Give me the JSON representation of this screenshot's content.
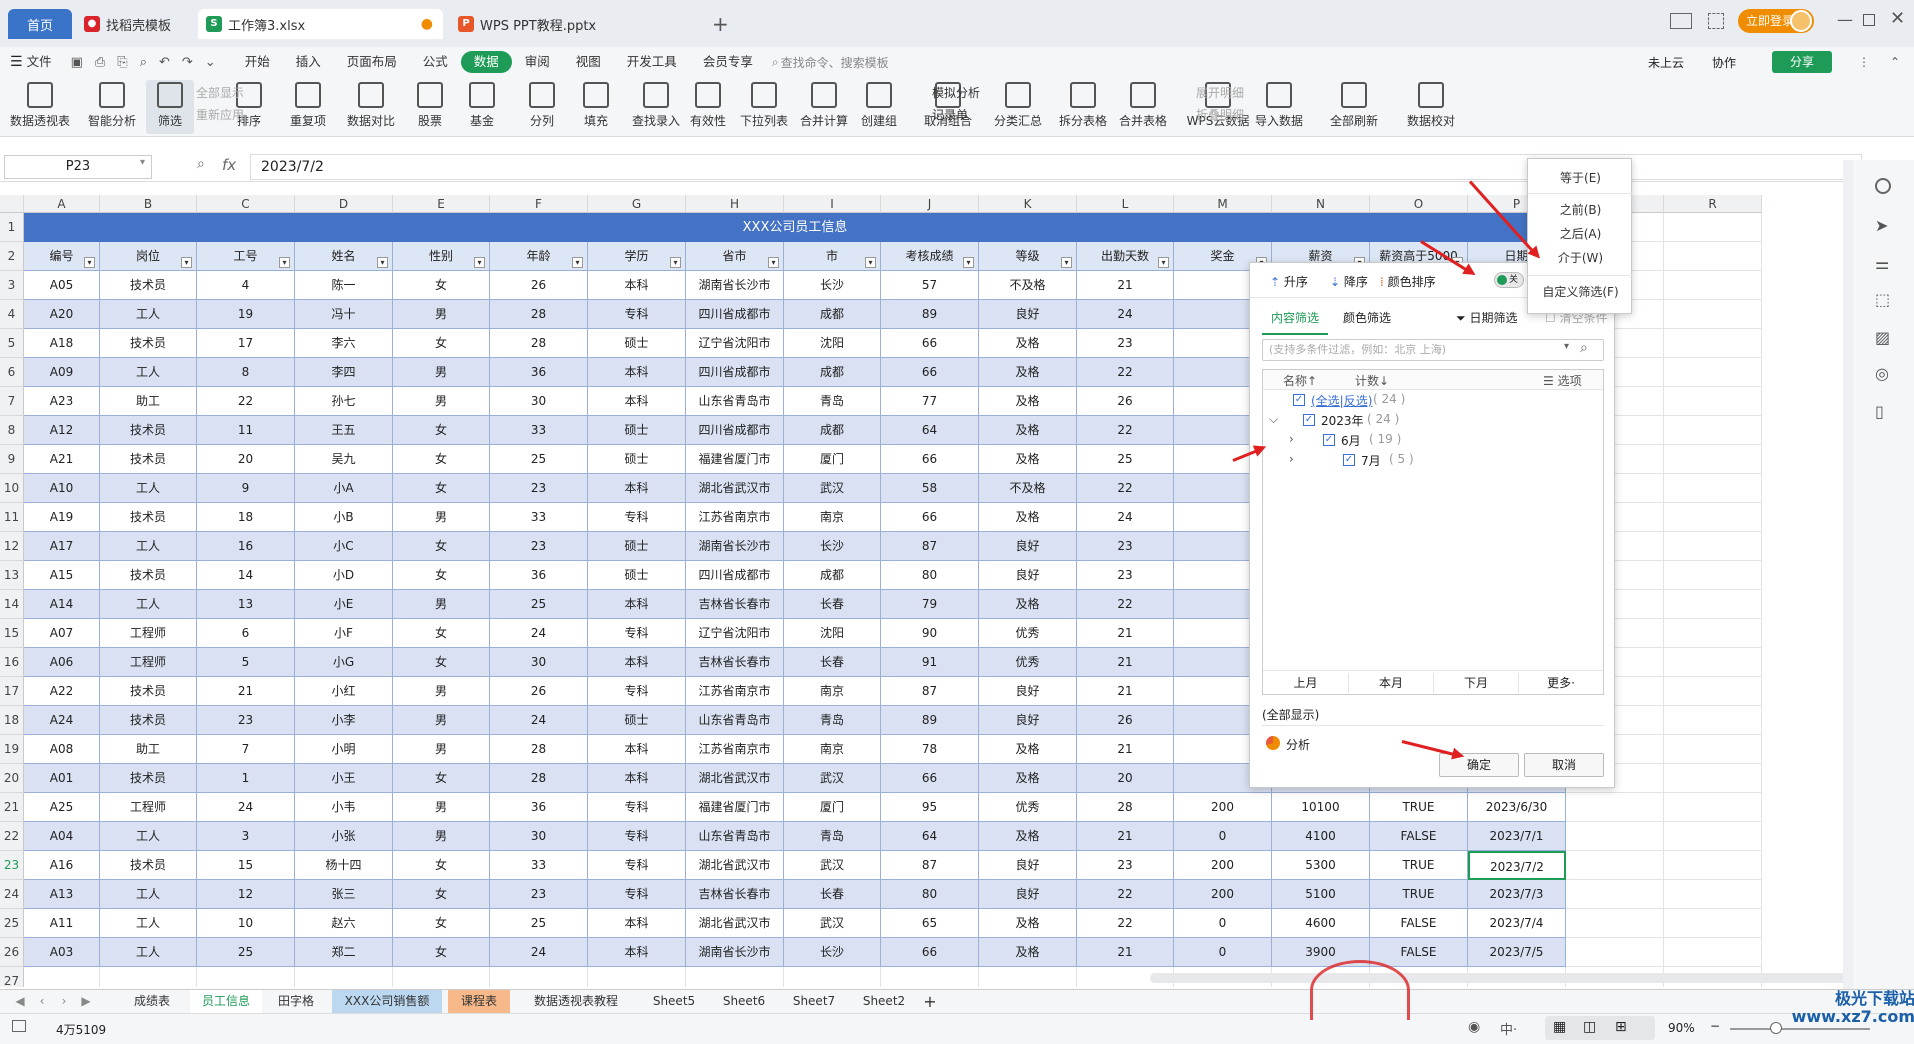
{
  "titlebar": {
    "tabs": [
      {
        "label": "首页"
      },
      {
        "label": "找稻壳模板"
      },
      {
        "label": "工作簿3.xlsx"
      },
      {
        "label": "WPS PPT教程.pptx"
      }
    ],
    "login": "立即登录"
  },
  "menu": {
    "items": [
      "文件",
      "开始",
      "插入",
      "页面布局",
      "公式",
      "数据",
      "审阅",
      "视图",
      "开发工具",
      "会员专享"
    ],
    "active": "数据",
    "search_placeholder": "查找命令、搜索模板",
    "cloud": "未上云",
    "collab": "协作",
    "share": "分享"
  },
  "ribbon": {
    "buttons": [
      "数据透视表",
      "智能分析",
      "筛选",
      "排序",
      "重复项",
      "数据对比",
      "股票",
      "基金",
      "分列",
      "填充",
      "查找录入",
      "有效性",
      "下拉列表",
      "合并计算",
      "创建组",
      "取消组合",
      "分类汇总",
      "拆分表格",
      "合并表格",
      "WPS云数据",
      "导入数据",
      "全部刷新",
      "数据校对"
    ],
    "small": {
      "show_all": "全部显示",
      "reapply": "重新应用",
      "sim_analysis": "模拟分析",
      "record": "记录单",
      "expand": "展开明细",
      "collapse": "折叠明细"
    }
  },
  "formula": {
    "cellref": "P23",
    "fx": "fx",
    "value": "2023/7/2"
  },
  "columns": [
    "A",
    "B",
    "C",
    "D",
    "E",
    "F",
    "G",
    "H",
    "I",
    "J",
    "K",
    "L",
    "M",
    "N",
    "O",
    "P",
    "Q",
    "R"
  ],
  "sheet_title": "XXX公司员工信息",
  "headers": [
    "编号",
    "岗位",
    "工号",
    "姓名",
    "性别",
    "年龄",
    "学历",
    "省市",
    "市",
    "考核成绩",
    "等级",
    "出勤天数",
    "奖金",
    "薪资",
    "薪资高于5000",
    "日期"
  ],
  "rows": [
    [
      "A05",
      "技术员",
      "4",
      "陈一",
      "女",
      "26",
      "本科",
      "湖南省长沙市",
      "长沙",
      "57",
      "不及格",
      "21",
      "",
      "",
      "",
      ""
    ],
    [
      "A20",
      "工人",
      "19",
      "冯十",
      "男",
      "28",
      "专科",
      "四川省成都市",
      "成都",
      "89",
      "良好",
      "24",
      "",
      "",
      "",
      ""
    ],
    [
      "A18",
      "技术员",
      "17",
      "李六",
      "女",
      "28",
      "硕士",
      "辽宁省沈阳市",
      "沈阳",
      "66",
      "及格",
      "23",
      "",
      "",
      "",
      ""
    ],
    [
      "A09",
      "工人",
      "8",
      "李四",
      "男",
      "36",
      "本科",
      "四川省成都市",
      "成都",
      "66",
      "及格",
      "22",
      "",
      "",
      "",
      ""
    ],
    [
      "A23",
      "助工",
      "22",
      "孙七",
      "男",
      "30",
      "本科",
      "山东省青岛市",
      "青岛",
      "77",
      "及格",
      "26",
      "",
      "",
      "",
      ""
    ],
    [
      "A12",
      "技术员",
      "11",
      "王五",
      "女",
      "33",
      "硕士",
      "四川省成都市",
      "成都",
      "64",
      "及格",
      "22",
      "",
      "",
      "",
      ""
    ],
    [
      "A21",
      "技术员",
      "20",
      "吴九",
      "女",
      "25",
      "硕士",
      "福建省厦门市",
      "厦门",
      "66",
      "及格",
      "25",
      "",
      "",
      "",
      ""
    ],
    [
      "A10",
      "工人",
      "9",
      "小A",
      "女",
      "23",
      "本科",
      "湖北省武汉市",
      "武汉",
      "58",
      "不及格",
      "22",
      "",
      "",
      "",
      ""
    ],
    [
      "A19",
      "技术员",
      "18",
      "小B",
      "男",
      "33",
      "专科",
      "江苏省南京市",
      "南京",
      "66",
      "及格",
      "24",
      "",
      "",
      "",
      ""
    ],
    [
      "A17",
      "工人",
      "16",
      "小C",
      "女",
      "23",
      "硕士",
      "湖南省长沙市",
      "长沙",
      "87",
      "良好",
      "23",
      "",
      "",
      "",
      ""
    ],
    [
      "A15",
      "技术员",
      "14",
      "小D",
      "女",
      "36",
      "硕士",
      "四川省成都市",
      "成都",
      "80",
      "良好",
      "23",
      "",
      "",
      "",
      ""
    ],
    [
      "A14",
      "工人",
      "13",
      "小E",
      "男",
      "25",
      "本科",
      "吉林省长春市",
      "长春",
      "79",
      "及格",
      "22",
      "",
      "",
      "",
      ""
    ],
    [
      "A07",
      "工程师",
      "6",
      "小F",
      "女",
      "24",
      "专科",
      "辽宁省沈阳市",
      "沈阳",
      "90",
      "优秀",
      "21",
      "",
      "",
      "",
      ""
    ],
    [
      "A06",
      "工程师",
      "5",
      "小G",
      "女",
      "30",
      "本科",
      "吉林省长春市",
      "长春",
      "91",
      "优秀",
      "21",
      "",
      "",
      "",
      ""
    ],
    [
      "A22",
      "技术员",
      "21",
      "小红",
      "男",
      "26",
      "专科",
      "江苏省南京市",
      "南京",
      "87",
      "良好",
      "21",
      "",
      "",
      "",
      ""
    ],
    [
      "A24",
      "技术员",
      "23",
      "小李",
      "男",
      "24",
      "硕士",
      "山东省青岛市",
      "青岛",
      "89",
      "良好",
      "26",
      "",
      "",
      "",
      ""
    ],
    [
      "A08",
      "助工",
      "7",
      "小明",
      "男",
      "28",
      "本科",
      "江苏省南京市",
      "南京",
      "78",
      "及格",
      "21",
      "",
      "",
      "",
      ""
    ],
    [
      "A01",
      "技术员",
      "1",
      "小王",
      "女",
      "28",
      "本科",
      "湖北省武汉市",
      "武汉",
      "66",
      "及格",
      "20",
      "",
      "",
      "",
      ""
    ],
    [
      "A25",
      "工程师",
      "24",
      "小韦",
      "男",
      "36",
      "专科",
      "福建省厦门市",
      "厦门",
      "95",
      "优秀",
      "28",
      "200",
      "10100",
      "TRUE",
      "2023/6/30"
    ],
    [
      "A04",
      "工人",
      "3",
      "小张",
      "男",
      "30",
      "专科",
      "山东省青岛市",
      "青岛",
      "64",
      "及格",
      "21",
      "0",
      "4100",
      "FALSE",
      "2023/7/1"
    ],
    [
      "A16",
      "技术员",
      "15",
      "杨十四",
      "女",
      "33",
      "专科",
      "湖北省武汉市",
      "武汉",
      "87",
      "良好",
      "23",
      "200",
      "5300",
      "TRUE",
      "2023/7/2"
    ],
    [
      "A13",
      "工人",
      "12",
      "张三",
      "女",
      "23",
      "专科",
      "吉林省长春市",
      "长春",
      "80",
      "良好",
      "22",
      "200",
      "5100",
      "TRUE",
      "2023/7/3"
    ],
    [
      "A11",
      "工人",
      "10",
      "赵六",
      "女",
      "25",
      "本科",
      "湖北省武汉市",
      "武汉",
      "65",
      "及格",
      "22",
      "0",
      "4600",
      "FALSE",
      "2023/7/4"
    ],
    [
      "A03",
      "工人",
      "25",
      "郑二",
      "女",
      "24",
      "本科",
      "湖南省长沙市",
      "长沙",
      "66",
      "及格",
      "21",
      "0",
      "3900",
      "FALSE",
      "2023/7/5"
    ]
  ],
  "filter_panel": {
    "asc": "升序",
    "desc": "降序",
    "color_sort": "颜色排序",
    "toggle": "关",
    "tab_content": "内容筛选",
    "tab_color": "颜色筛选",
    "date_filter": "日期筛选",
    "clear": "清空条件",
    "search_placeholder": "(支持多条件过滤，例如：北京 上海)",
    "col_name": "名称↑",
    "col_count": "计数↓",
    "options": "选项",
    "tree": [
      {
        "label": "(全选|反选)",
        "count": "( 24 )"
      },
      {
        "label": "2023年",
        "count": "( 24 )"
      },
      {
        "label": "6月",
        "count": "( 19 )"
      },
      {
        "label": "7月",
        "count": "( 5 )"
      }
    ],
    "quick": [
      "上月",
      "本月",
      "下月",
      "更多·"
    ],
    "show_all": "(全部显示)",
    "analyze": "分析",
    "ok": "确定",
    "cancel": "取消"
  },
  "date_menu": [
    "等于(E)",
    "之前(B)",
    "之后(A)",
    "介于(W)",
    "自定义筛选(F)"
  ],
  "sheets": [
    "成绩表",
    "员工信息",
    "田字格",
    "XXX公司销售额",
    "课程表",
    "数据透视表教程",
    "Sheet5",
    "Sheet6",
    "Sheet7",
    "Sheet2"
  ],
  "active_sheet": "员工信息",
  "status": {
    "left": "4万5109",
    "zoom": "90%"
  },
  "watermark": "极光下载站 www.xz7.com",
  "colors": {
    "header_blue": "#4472c4",
    "band": "#d9e1f2",
    "accent_green": "#1e9b56",
    "arrow_red": "#e02020"
  }
}
